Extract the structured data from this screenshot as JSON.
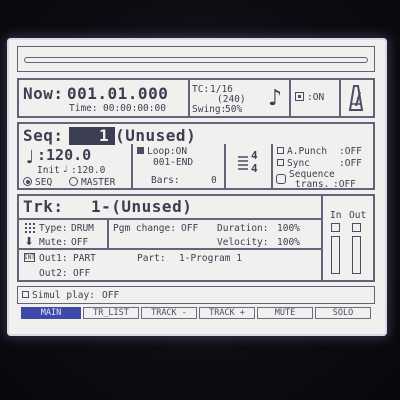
{
  "now": {
    "label": "Now:",
    "position": "001.01.000",
    "time_label": "Time:",
    "time": "00:00:00:00"
  },
  "tc": {
    "label": "TC:",
    "value": "1/16",
    "sub": "(240)",
    "swing_label": "Swing:",
    "swing": "50%"
  },
  "status": {
    "on_label": ":ON"
  },
  "seq": {
    "label": "Seq:",
    "number": "1",
    "name": "-(Unused)",
    "tempo": ":120.0",
    "init_label": "Init",
    "init_tempo": ":120.0",
    "source_seq": "SEQ",
    "source_master": "MASTER",
    "loop_label": "Loop:ON",
    "loop_range": "001-END",
    "bars_label": "Bars:",
    "bars": "0",
    "ts_top": "4",
    "ts_bottom": "4",
    "apunch_label": "A.Punch",
    "apunch": ":OFF",
    "sync_label": "Sync",
    "sync": ":OFF",
    "seqtrans_label1": "Sequence",
    "seqtrans_label2": "trans.",
    "seqtrans": ":OFF"
  },
  "trk": {
    "label": "Trk:",
    "value": "1-(Unused)",
    "type_label": "Type:",
    "type": "DRUM",
    "mute_label": "Mute:",
    "mute": "OFF",
    "pgm_change_label": "Pgm change:",
    "pgm_change": "OFF",
    "duration_label": "Duration:",
    "duration": "100%",
    "velocity_label": "Velocity:",
    "velocity": "100%",
    "out1_label": "Out1:",
    "out1": "PART",
    "part_label": "Part:",
    "part": "1-Program 1",
    "out2_label": "Out2:",
    "out2": "OFF",
    "in_label": "In",
    "out_label": "Out"
  },
  "simul": {
    "label": "Simul play:",
    "value": "OFF"
  },
  "tabs": [
    "MAIN",
    "TR_LIST",
    "TRACK -",
    "TRACK +",
    "MUTE",
    "SOLO"
  ],
  "colors": {
    "lcd_bg": "#f2f0ee",
    "ink": "#3c3f52",
    "active_tab": "#3d4aa8"
  }
}
